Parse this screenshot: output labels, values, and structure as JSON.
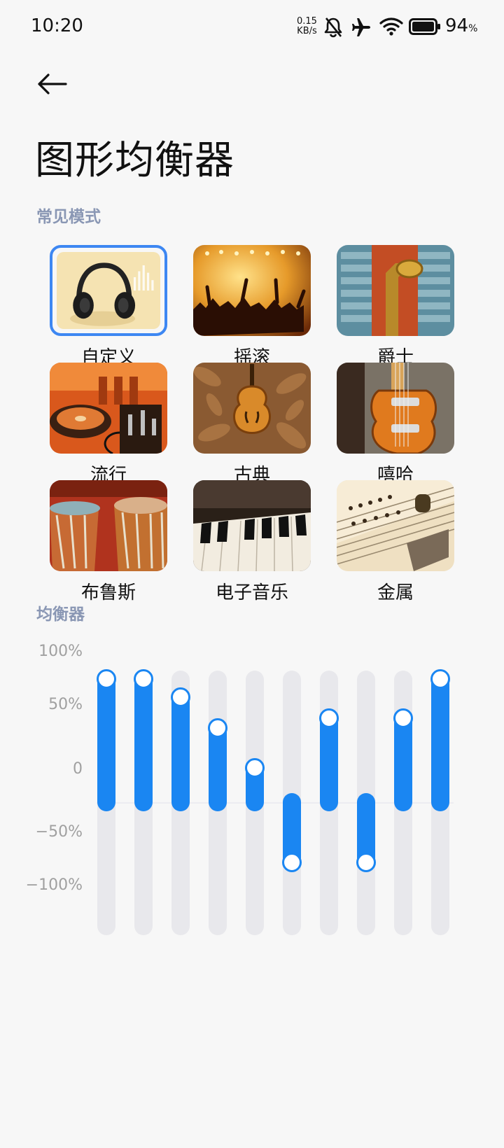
{
  "status_bar": {
    "time": "10:20",
    "net_speed_value": "0.15",
    "net_speed_unit": "KB/s",
    "battery_level": "94",
    "battery_unit": "%"
  },
  "header": {
    "title": "图形均衡器"
  },
  "presets_section": {
    "title": "常见模式",
    "items": [
      {
        "label": "自定义",
        "selected": true,
        "icon": "headphones-icon"
      },
      {
        "label": "摇滚",
        "selected": false,
        "icon": "concert-crowd-image"
      },
      {
        "label": "爵士",
        "selected": false,
        "icon": "saxophone-image"
      },
      {
        "label": "流行",
        "selected": false,
        "icon": "dj-turntable-image"
      },
      {
        "label": "古典",
        "selected": false,
        "icon": "violin-image"
      },
      {
        "label": "嘻哈",
        "selected": false,
        "icon": "electric-guitar-image"
      },
      {
        "label": "布鲁斯",
        "selected": false,
        "icon": "drums-image"
      },
      {
        "label": "电子音乐",
        "selected": false,
        "icon": "keyboard-image"
      },
      {
        "label": "金属",
        "selected": false,
        "icon": "guitar-strings-image"
      }
    ]
  },
  "equalizer": {
    "title": "均衡器",
    "axis_labels": [
      "100%",
      "50%",
      "0",
      "−50%",
      "−100%"
    ],
    "range": [
      -100,
      100
    ],
    "bands": [
      100,
      100,
      85,
      60,
      28,
      -67,
      68,
      -67,
      68,
      100
    ]
  },
  "colors": {
    "accent": "#1a86f2",
    "section_title": "#8a97b4",
    "track": "#e8e8ec",
    "background": "#f7f7f7"
  }
}
